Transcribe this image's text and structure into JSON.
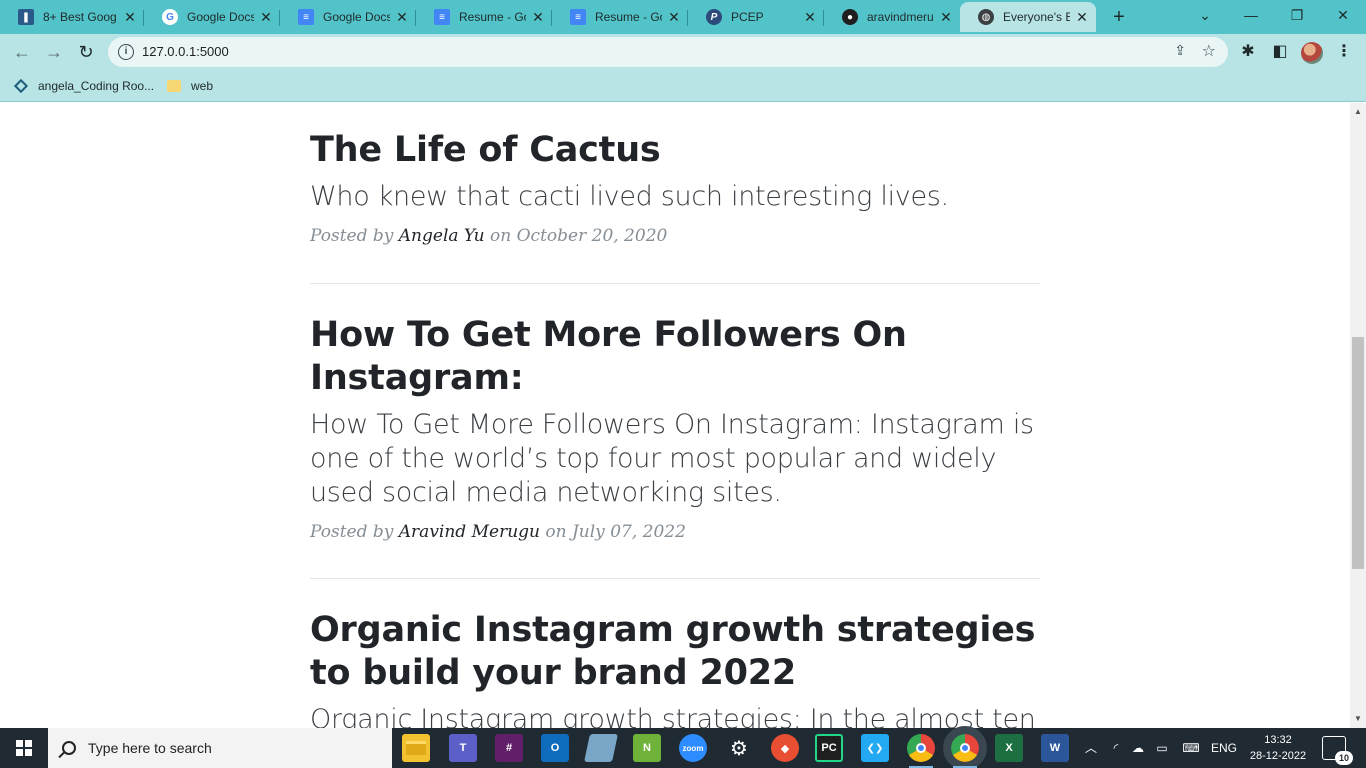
{
  "browser": {
    "tabs": [
      {
        "label": "8+ Best Goog",
        "icon": "bookmark-icon",
        "color": "#2b5a8a"
      },
      {
        "label": "Google Docs",
        "icon": "google-icon",
        "color": "#ffffff"
      },
      {
        "label": "Google Docs",
        "icon": "docs-icon",
        "color": "#4285f4"
      },
      {
        "label": "Resume - Goo",
        "icon": "docs-icon",
        "color": "#4285f4"
      },
      {
        "label": "Resume - Goo",
        "icon": "docs-icon",
        "color": "#4285f4"
      },
      {
        "label": "PCEP",
        "icon": "pcep-icon",
        "color": "#2c4a7a"
      },
      {
        "label": "aravindmerug",
        "icon": "github-icon",
        "color": "#1f1f1f"
      },
      {
        "label": "Everyone's Bl",
        "icon": "globe-icon",
        "color": "#3c4043"
      }
    ],
    "url": "127.0.0.1:5000",
    "bookmarks": [
      {
        "label": "angela_Coding Roo...",
        "icon": "coding-room-icon"
      },
      {
        "label": "web",
        "icon": "folder-icon"
      }
    ]
  },
  "posts": [
    {
      "title": "The Life of Cactus",
      "subtitle": "Who knew that cacti lived such interesting lives.",
      "meta_prefix": "Posted by",
      "author": "Angela Yu",
      "meta_on": "on",
      "date": "October 20, 2020"
    },
    {
      "title": "How To Get More Followers On Instagram:",
      "subtitle": "How To Get More Followers On Instagram: Instagram is one of the world’s top four most popular and widely used social media networking sites.",
      "meta_prefix": "Posted by",
      "author": "Aravind Merugu",
      "meta_on": "on",
      "date": "July 07, 2022"
    },
    {
      "title": "Organic Instagram growth strategies to build your brand 2022",
      "subtitle": "Organic Instagram growth strategies: In the almost ten"
    }
  ],
  "taskbar": {
    "search_placeholder": "Type here to search",
    "apps": [
      {
        "name": "file-explorer",
        "label": "",
        "color": "#f2c230"
      },
      {
        "name": "teams",
        "label": "T",
        "color": "#5b5fc7"
      },
      {
        "name": "slack",
        "label": "#",
        "color": "#611f69"
      },
      {
        "name": "outlook",
        "label": "O",
        "color": "#0f6cbd"
      },
      {
        "name": "notepad",
        "label": "",
        "color": "#7aa7c7"
      },
      {
        "name": "notepadplusplus",
        "label": "N",
        "color": "#6fb23a"
      },
      {
        "name": "zoom",
        "label": "zoom",
        "color": "#2d8cff"
      },
      {
        "name": "settings",
        "label": "⚙",
        "color": "#1f2a33"
      },
      {
        "name": "git",
        "label": "◆",
        "color": "#e84e31"
      },
      {
        "name": "pycharm",
        "label": "PC",
        "color": "#1f1f1f"
      },
      {
        "name": "vscode",
        "label": "❮❯",
        "color": "#23a9f2"
      },
      {
        "name": "chrome",
        "label": "",
        "color": "#e8453c"
      },
      {
        "name": "chrome-active",
        "label": "",
        "color": "#e8453c"
      },
      {
        "name": "excel",
        "label": "X",
        "color": "#1d6f42"
      },
      {
        "name": "word",
        "label": "W",
        "color": "#2b579a"
      }
    ],
    "language": "ENG",
    "time": "13:32",
    "date": "28-12-2022",
    "notification_count": "10"
  }
}
